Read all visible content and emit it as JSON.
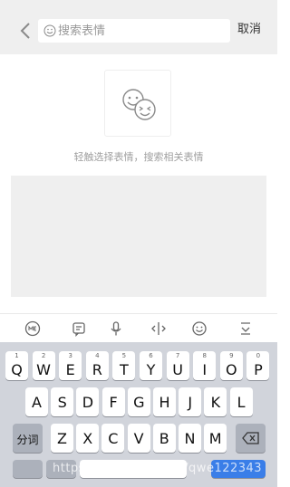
{
  "search": {
    "placeholder": "搜索表情",
    "cancel_label": "取消"
  },
  "hint": {
    "text": "轻触选择表情，搜索相关表情"
  },
  "toolbar": {
    "icons": [
      "app-logo-icon",
      "list-icon",
      "microphone-icon",
      "cursor-move-icon",
      "emoji-icon",
      "keyboard-hide-icon"
    ]
  },
  "keyboard": {
    "row1": [
      {
        "num": "1",
        "ch": "Q"
      },
      {
        "num": "2",
        "ch": "W"
      },
      {
        "num": "3",
        "ch": "E"
      },
      {
        "num": "4",
        "ch": "R"
      },
      {
        "num": "5",
        "ch": "T"
      },
      {
        "num": "6",
        "ch": "Y"
      },
      {
        "num": "7",
        "ch": "U"
      },
      {
        "num": "8",
        "ch": "I"
      },
      {
        "num": "9",
        "ch": "O"
      },
      {
        "num": "0",
        "ch": "P"
      }
    ],
    "row2": [
      "A",
      "S",
      "D",
      "F",
      "G",
      "H",
      "J",
      "K",
      "L"
    ],
    "row3": [
      "Z",
      "X",
      "C",
      "V",
      "B",
      "N",
      "M"
    ],
    "split_label": "分词"
  },
  "watermark": "https://blog.csdn.net/qwe122343"
}
